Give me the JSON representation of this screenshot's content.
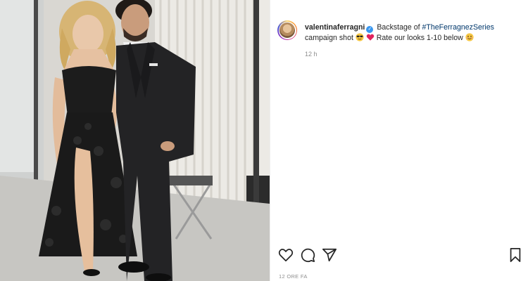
{
  "post": {
    "username": "valentinaferragni",
    "verified_icon": "verified-badge-icon",
    "caption_text_1": " Backstage of ",
    "hashtag": "#TheFerragnezSeries",
    "caption_text_2": " campaign shot ",
    "caption_text_3": " Rate our looks 1-10 below ",
    "emoji_1": "sunglasses-emoji",
    "emoji_2": "red-heart-emoji",
    "emoji_3": "smiling-emoji",
    "relative_time": "12 h",
    "date_label": "12 ORE FA"
  },
  "actions": {
    "like": "heart-icon",
    "comment": "comment-icon",
    "share": "paper-plane-icon",
    "save": "bookmark-icon"
  },
  "colors": {
    "text": "#262626",
    "muted": "#8e8e8e",
    "hashtag": "#00376b",
    "verified": "#3897f0",
    "heart_emoji": "#e0245e"
  }
}
